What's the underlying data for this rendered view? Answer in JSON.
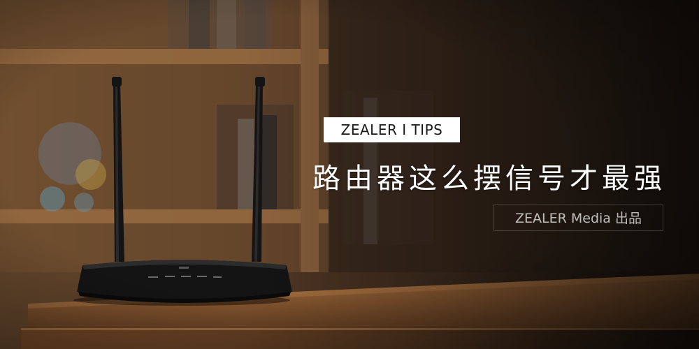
{
  "badge": {
    "text": "ZEALER I TIPS"
  },
  "headline": {
    "text": "路由器这么摆信号才最强"
  },
  "credit": {
    "text": "ZEALER  Media 出品"
  },
  "scene": {
    "subject": "wireless-router-icon",
    "colors": {
      "wood": "#8a5a34",
      "router": "#121212",
      "wall": "#3a2a1e"
    }
  }
}
